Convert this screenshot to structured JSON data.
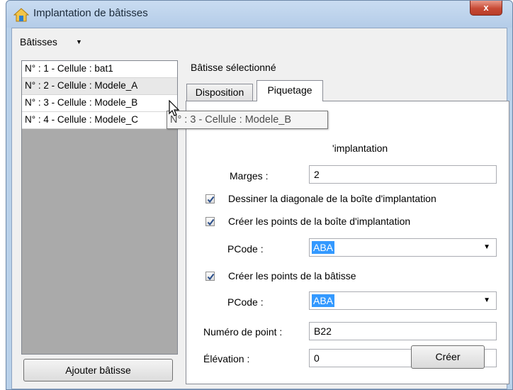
{
  "window": {
    "title": "Implantation de bâtisses",
    "close_label": "x"
  },
  "menu": {
    "batisses_label": "Bâtisses",
    "arrow": "▼"
  },
  "list": {
    "items": [
      "N° : 1 - Cellule : bat1",
      "N° : 2 - Cellule : Modele_A",
      "N° : 3 - Cellule : Modele_B",
      "N° : 4 - Cellule : Modele_C"
    ],
    "tooltip": "N° : 3 - Cellule : Modele_B"
  },
  "add_button_label": "Ajouter bâtisse",
  "selected_label": "Bâtisse sélectionné",
  "tabs": {
    "disposition": "Disposition",
    "piquetage": "Piquetage"
  },
  "form": {
    "box_label_partial": "'implantation",
    "marges_label": "Marges :",
    "marges_value": "2",
    "diag_label": "Dessiner la diagonale de la boîte d'implantation",
    "box_points_label": "Créer les points de la boîte d'implantation",
    "pcode1_label": "PCode :",
    "pcode1_value": "ABA",
    "bat_points_label": "Créer les points de la bâtisse",
    "pcode2_label": "PCode :",
    "pcode2_value": "ABA",
    "numero_label": "Numéro de point :",
    "numero_value": "B22",
    "elevation_label": "Élévation :",
    "elevation_value": "0",
    "creer_label": "Créer"
  }
}
